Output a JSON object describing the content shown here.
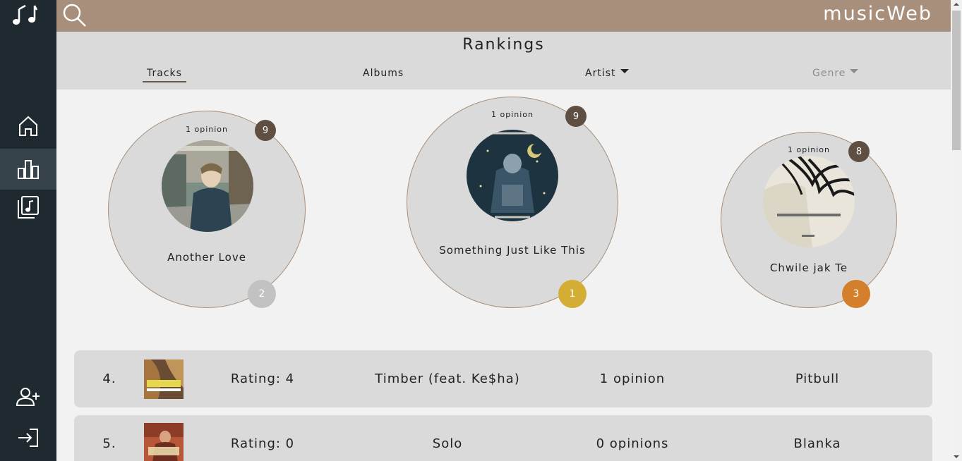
{
  "app": {
    "brand": "musicWeb"
  },
  "sidebar": {
    "items": [
      {
        "name": "logo",
        "icon": "music-notes-icon"
      },
      {
        "name": "home",
        "icon": "home-icon"
      },
      {
        "name": "rankings",
        "icon": "bar-chart-icon",
        "active": true
      },
      {
        "name": "library",
        "icon": "music-library-icon"
      },
      {
        "name": "register",
        "icon": "add-user-icon"
      },
      {
        "name": "login",
        "icon": "login-icon"
      }
    ]
  },
  "page": {
    "title": "Rankings",
    "tabs": [
      {
        "label": "Tracks",
        "active": true
      },
      {
        "label": "Albums"
      },
      {
        "label": "Artist",
        "dropdown": true
      },
      {
        "label": "Genre",
        "dropdown": true,
        "disabled": true
      }
    ]
  },
  "podium": [
    {
      "rank": "2",
      "name": "Another Love",
      "opinions": "1 opinion",
      "score": "9",
      "rank_color": "#c2c2c2"
    },
    {
      "rank": "1",
      "name": "Something Just Like This",
      "opinions": "1 opinion",
      "score": "9",
      "rank_color": "#d4ad34"
    },
    {
      "rank": "3",
      "name": "Chwile jak Te",
      "opinions": "1 opinion",
      "score": "8",
      "rank_color": "#d47f2c"
    }
  ],
  "rows": [
    {
      "position": "4.",
      "rating": "Rating: 4",
      "title": "Timber (feat. Ke$ha)",
      "opinions": "1 opinion",
      "artist": "Pitbull"
    },
    {
      "position": "5.",
      "rating": "Rating: 0",
      "title": "Solo",
      "opinions": "0 opinions",
      "artist": "Blanka"
    }
  ],
  "colors": {
    "sidebar": "#1f2a30",
    "topbar": "#a88f7b",
    "score_badge": "#5e4f42"
  }
}
